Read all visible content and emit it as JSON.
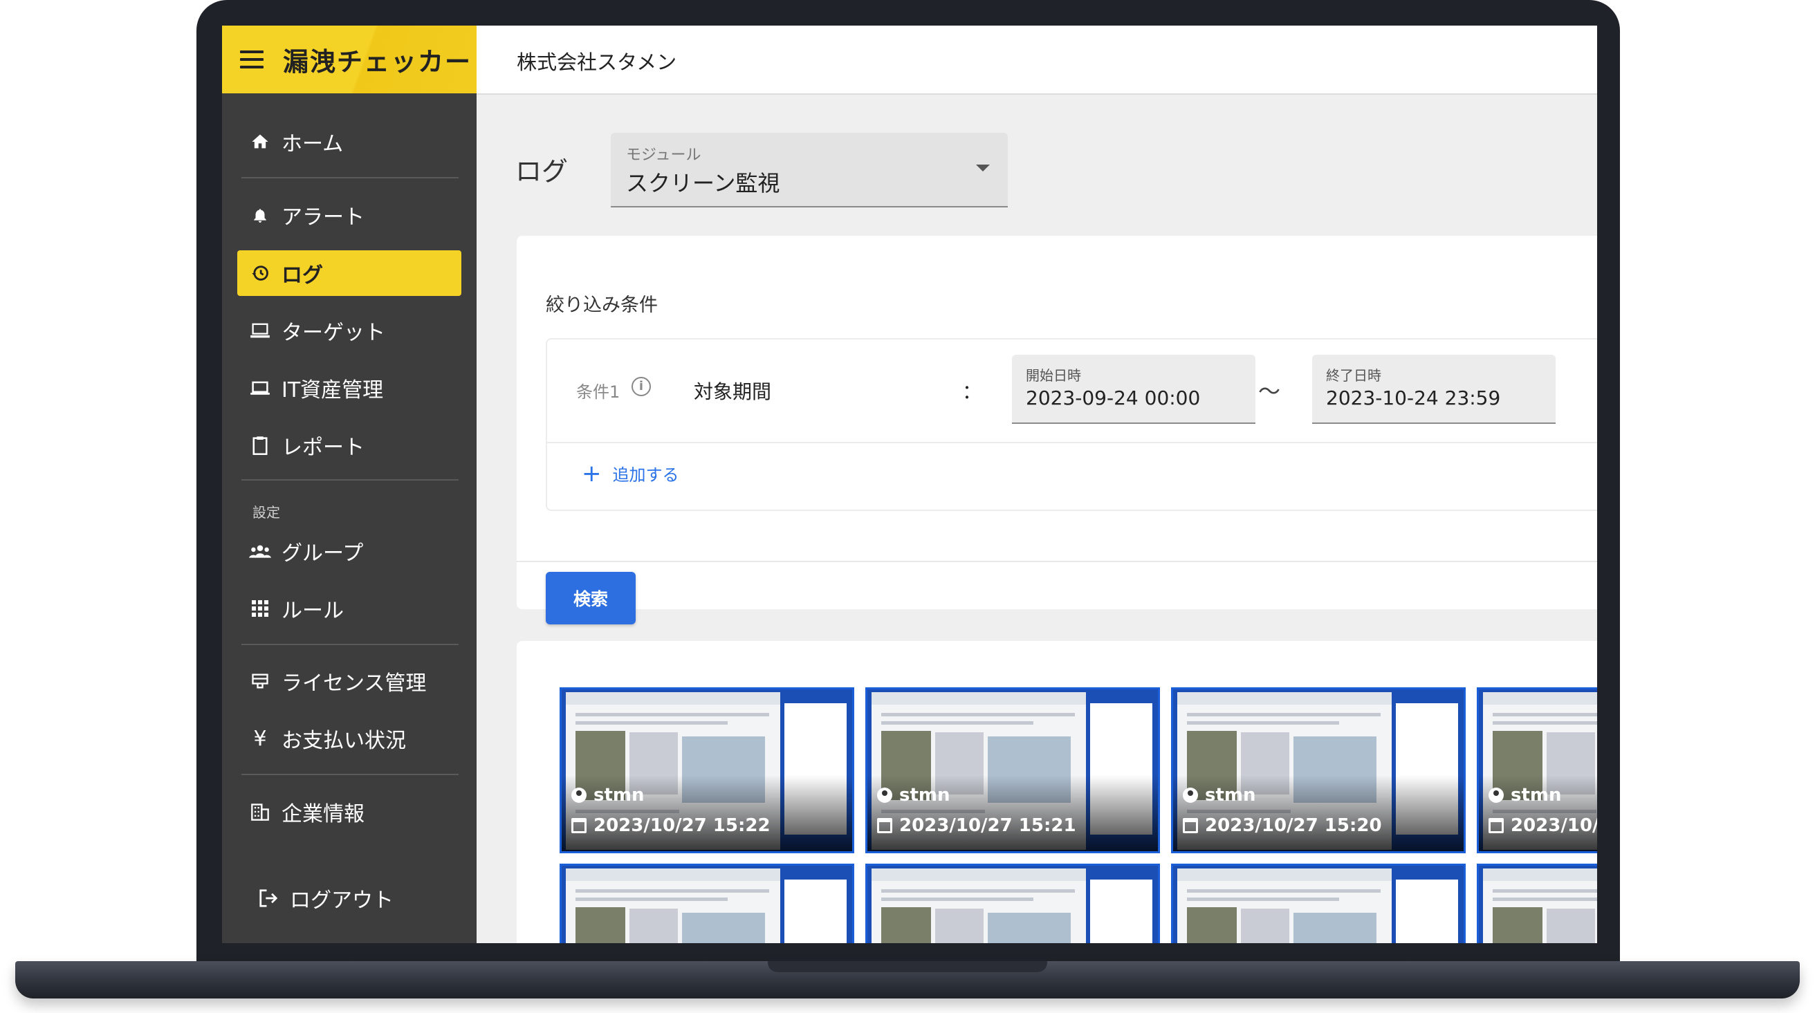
{
  "app": {
    "logo": "漏洩チェッカー",
    "company": "株式会社スタメン"
  },
  "sidebar": {
    "items": [
      {
        "label": "ホーム",
        "icon": "home-icon"
      },
      {
        "label": "アラート",
        "icon": "bell-icon"
      },
      {
        "label": "ログ",
        "icon": "history-icon",
        "active": true
      },
      {
        "label": "ターゲット",
        "icon": "target-device-icon"
      },
      {
        "label": "IT資産管理",
        "icon": "laptop-icon"
      },
      {
        "label": "レポート",
        "icon": "clipboard-icon"
      }
    ],
    "settings_label": "設定",
    "settings_items": [
      {
        "label": "グループ",
        "icon": "group-icon"
      },
      {
        "label": "ルール",
        "icon": "grid-icon"
      }
    ],
    "billing_items": [
      {
        "label": "ライセンス管理",
        "icon": "license-icon"
      },
      {
        "label": "お支払い状況",
        "icon": "yen-icon"
      }
    ],
    "company_item": {
      "label": "企業情報",
      "icon": "building-icon"
    },
    "logout": {
      "label": "ログアウト",
      "icon": "logout-icon"
    }
  },
  "page": {
    "title": "ログ",
    "module": {
      "label": "モジュール",
      "value": "スクリーン監視"
    }
  },
  "filter": {
    "heading": "絞り込み条件",
    "condition": {
      "label": "条件1",
      "name": "対象期間",
      "colon": "：",
      "start": {
        "label": "開始日時",
        "value": "2023-09-24 00:00"
      },
      "tilde": "〜",
      "end": {
        "label": "終了日時",
        "value": "2023-10-24 23:59"
      }
    },
    "add_label": "追加する",
    "search_label": "検索"
  },
  "results": [
    {
      "user": "stmn",
      "time": "2023/10/27 15:22"
    },
    {
      "user": "stmn",
      "time": "2023/10/27 15:21"
    },
    {
      "user": "stmn",
      "time": "2023/10/27 15:20"
    },
    {
      "user": "stmn",
      "time": "2023/10/27"
    }
  ],
  "colors": {
    "accent": "#f5d226",
    "sidebar": "#3d3d3d",
    "primary": "#2d6fe0"
  }
}
